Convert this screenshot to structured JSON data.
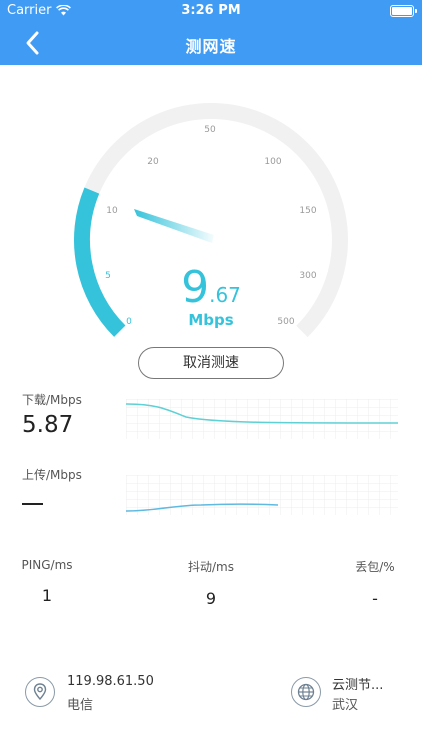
{
  "status_bar": {
    "carrier": "Carrier",
    "time": "3:26 PM"
  },
  "nav": {
    "title": "测网速"
  },
  "gauge": {
    "ticks": [
      "0",
      "5",
      "10",
      "20",
      "50",
      "100",
      "150",
      "300",
      "500"
    ],
    "speed_int": "9",
    "speed_dec": ".67",
    "unit": "Mbps"
  },
  "cancel_button": "取消测速",
  "download": {
    "label": "下载/Mbps",
    "value": "5.87"
  },
  "upload": {
    "label": "上传/Mbps"
  },
  "metrics": [
    {
      "label": "PING/ms",
      "value": "1"
    },
    {
      "label": "抖动/ms",
      "value": "9"
    },
    {
      "label": "丢包/%",
      "value": "-"
    }
  ],
  "client": {
    "ip": "119.98.61.50",
    "isp": "电信"
  },
  "server": {
    "name": "云测节...",
    "city": "武汉"
  },
  "colors": {
    "nav": "#3f9bf3",
    "accent": "#35c3db",
    "track": "#f1f1f1"
  }
}
